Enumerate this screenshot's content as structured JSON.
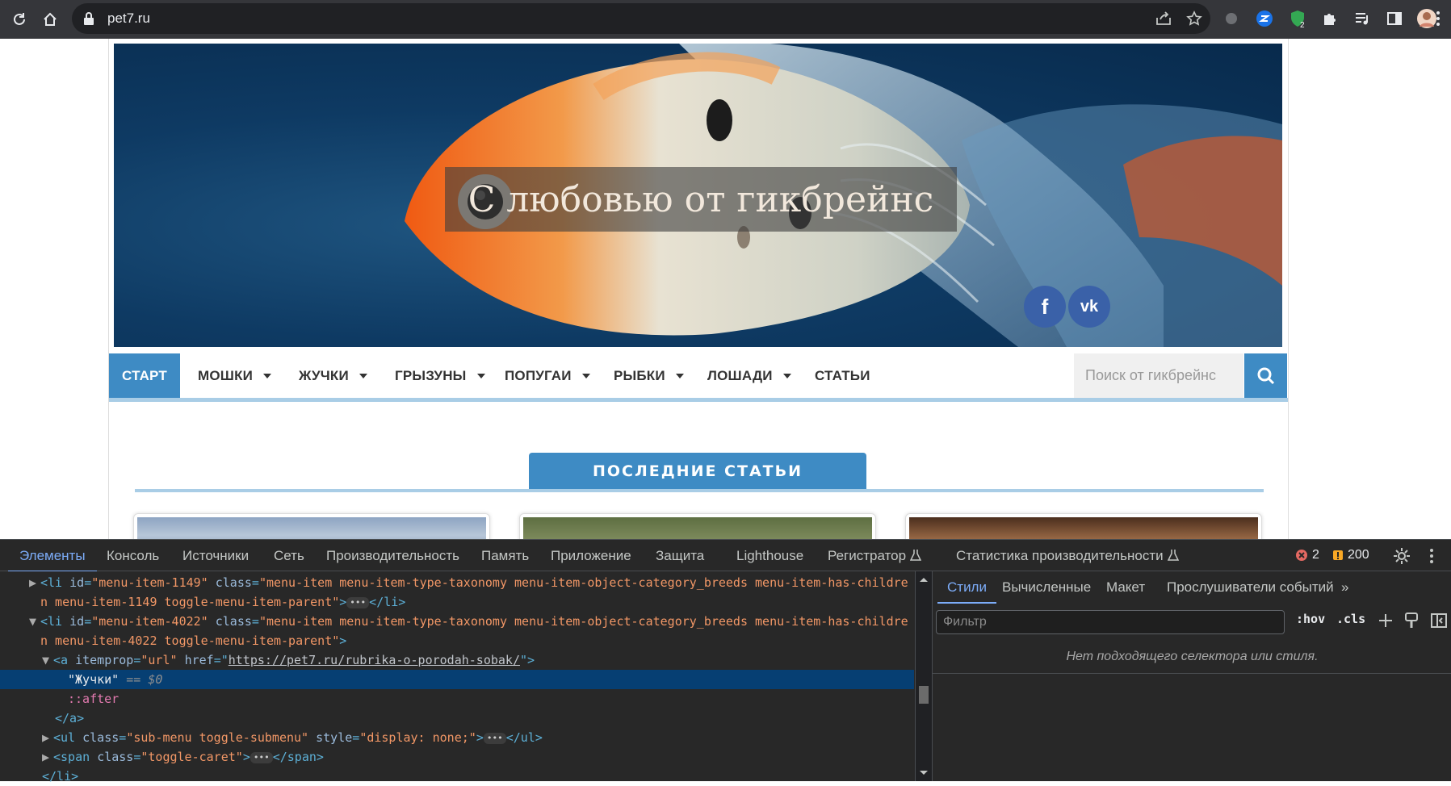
{
  "browser": {
    "url": "pet7.ru",
    "warning_count_badge": "2"
  },
  "site": {
    "title": "С любовью от гикбрейнс",
    "social": {
      "facebook": "f",
      "vk": "vk"
    },
    "menu": [
      {
        "label": "СТАРТ",
        "active": true,
        "has_submenu": false
      },
      {
        "label": "МОШКИ",
        "active": false,
        "has_submenu": true
      },
      {
        "label": "ЖУЧКИ",
        "active": false,
        "has_submenu": true
      },
      {
        "label": "ГРЫЗУНЫ",
        "active": false,
        "has_submenu": true
      },
      {
        "label": "ПОПУГАИ",
        "active": false,
        "has_submenu": true
      },
      {
        "label": "РЫБКИ",
        "active": false,
        "has_submenu": true
      },
      {
        "label": "ЛОШАДИ",
        "active": false,
        "has_submenu": true
      },
      {
        "label": "СТАТЬИ",
        "active": false,
        "has_submenu": false
      }
    ],
    "search_placeholder": "Поиск от гикбрейнс",
    "section_title": "ПОСЛЕДНИЕ СТАТЬИ",
    "accent_color": "#3e8bc4"
  },
  "devtools": {
    "tabs": [
      "Элементы",
      "Консоль",
      "Источники",
      "Сеть",
      "Производительность",
      "Память",
      "Приложение",
      "Защита",
      "Lighthouse",
      "Регистратор",
      "Статистика производительности"
    ],
    "errors": "2",
    "warnings": "200",
    "dom": {
      "l1_open": "<li ",
      "l1_id_attr": "id",
      "l1_id_val": "\"menu-item-1149\"",
      "l1_class_attr": "class",
      "l1_class_val": "\"menu-item menu-item-type-taxonomy menu-item-object-category_breeds menu-item-has-childre",
      "l1_cont": "n menu-item-1149 toggle-menu-item-parent\"",
      "l1_close": "</li>",
      "l2_id_val": "\"menu-item-4022\"",
      "l2_class_val": "\"menu-item menu-item-type-taxonomy menu-item-object-category_breeds menu-item-has-childre",
      "l2_cont": "n menu-item-4022 toggle-menu-item-parent\"",
      "a_itemprop_attr": "itemprop",
      "a_itemprop_val": "\"url\"",
      "a_href_attr": "href",
      "a_href_val": "https://pet7.ru/rubrika-o-porodah-sobak/",
      "selected_text": "\"Жучки\"",
      "selected_suffix": "== $0",
      "pseudo_after": "::after",
      "a_close": "</a>",
      "ul_class_val": "\"sub-menu toggle-submenu\"",
      "ul_style_attr": "style",
      "ul_style_val": "\"display: none;\"",
      "ul_close": "</ul>",
      "span_class_val": "\"toggle-caret\"",
      "span_close": "</span>",
      "li_close": "</li>"
    },
    "styles": {
      "tabs": [
        "Стили",
        "Вычисленные",
        "Макет",
        "Прослушиватели событий"
      ],
      "filter_placeholder": "Фильтр",
      "hov": ":hov",
      "cls": ".cls",
      "no_match": "Нет подходящего селектора или стиля."
    }
  }
}
